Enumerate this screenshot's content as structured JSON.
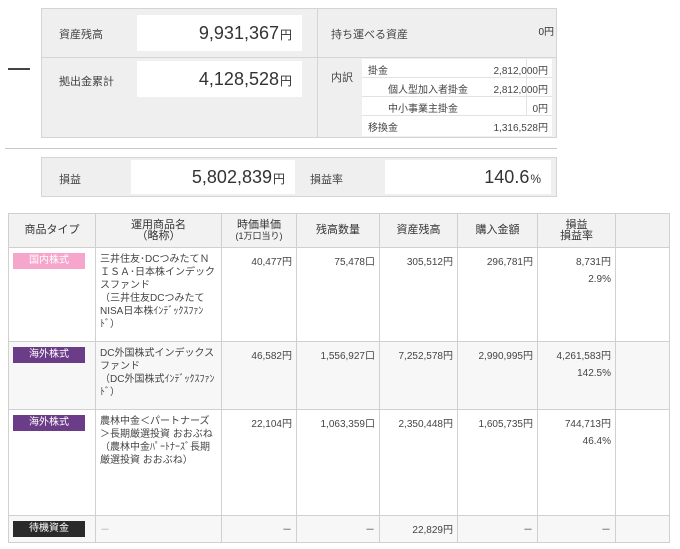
{
  "summary": {
    "asset_balance_label": "資産残高",
    "asset_balance_value": "9,931,367",
    "contribution_total_label": "拠出金累計",
    "contribution_total_value": "4,128,528",
    "unit_yen": "円",
    "carry_label": "持ち運べる資産",
    "carry_value": "0円",
    "breakdown_label": "内訳",
    "breakdown": {
      "kakekin_label": "掛金",
      "kakekin_value": "2,812,000円",
      "individual_label": "個人型加入者掛金",
      "individual_value": "2,812,000円",
      "sme_label": "中小事業主掛金",
      "sme_value": "0円",
      "transfer_label": "移換金",
      "transfer_value": "1,316,528円"
    }
  },
  "profit": {
    "label": "損益",
    "value": "5,802,839",
    "unit": "円",
    "rate_label": "損益率",
    "rate_value": "140.6",
    "rate_unit": "%"
  },
  "table": {
    "headers": {
      "type": "商品タイプ",
      "name": "運用商品名",
      "name_sub": "（略称）",
      "unit_price": "時価単価",
      "unit_price_sub": "(1万口当り)",
      "quantity": "残高数量",
      "balance": "資産残高",
      "purchase": "購入金額",
      "pl": "損益",
      "pl_rate": "損益率"
    },
    "rows": [
      {
        "type": "国内株式",
        "name": "三井住友･DCつみたてＮＩＳＡ･日本株インデックスファンド",
        "name_short": "（三井住友DCつみたてNISA日本株ｲﾝﾃﾞｯｸｽﾌｧﾝﾄﾞ）",
        "unit_price": "40,477円",
        "quantity": "75,478口",
        "balance": "305,512円",
        "purchase": "296,781円",
        "pl": "8,731円",
        "pl_rate": "2.9%"
      },
      {
        "type": "海外株式",
        "name": "DC外国株式インデックスファンド",
        "name_short": "（DC外国株式ｲﾝﾃﾞｯｸｽﾌｧﾝﾄﾞ）",
        "unit_price": "46,582円",
        "quantity": "1,556,927口",
        "balance": "7,252,578円",
        "purchase": "2,990,995円",
        "pl": "4,261,583円",
        "pl_rate": "142.5%"
      },
      {
        "type": "海外株式",
        "name": "農林中金＜パートナーズ＞長期厳選投資 おおぶね",
        "name_short": "（農林中金ﾊﾟｰﾄﾅｰｽﾞ長期厳選投資 おおぶね）",
        "unit_price": "22,104円",
        "quantity": "1,063,359口",
        "balance": "2,350,448円",
        "purchase": "1,605,735円",
        "pl": "744,713円",
        "pl_rate": "46.4%"
      },
      {
        "type": "待機資金",
        "name": "－",
        "unit_price": "－",
        "quantity": "－",
        "balance": "22,829円",
        "purchase": "－",
        "pl": "－"
      }
    ]
  },
  "colors": {
    "domestic_badge": "#f6a6cc",
    "foreign_badge": "#6b3c88",
    "cash_badge": "#2a2a2a",
    "link": "#1a5fb4"
  }
}
